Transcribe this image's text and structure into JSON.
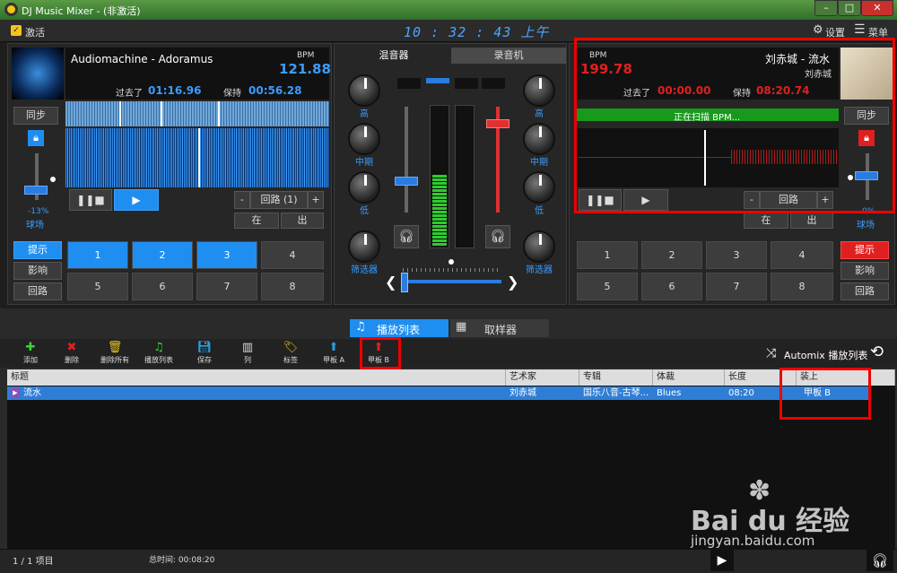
{
  "window": {
    "title": "DJ Music Mixer - (非激活)"
  },
  "menu": {
    "activate": "激活",
    "settings": "设置",
    "menu": "菜单"
  },
  "clock": "10 : 32 : 43 上午",
  "deckA": {
    "title": "Audiomachine - Adoramus",
    "bpm_label": "BPM",
    "bpm": "121.88",
    "elapsed_label": "过去了",
    "elapsed": "01:16.96",
    "remain_label": "保持",
    "remain": "00:56.28",
    "sync": "同步",
    "pitch": "-13%",
    "pitch_label": "球场",
    "loop": "回路 (1)",
    "loop_minus": "-",
    "loop_plus": "+",
    "in": "在",
    "out": "出",
    "cue": "提示",
    "effect": "影响",
    "loopbtn": "回路",
    "pads": [
      "1",
      "2",
      "3",
      "4",
      "5",
      "6",
      "7",
      "8"
    ],
    "pitch_level": 0.4
  },
  "mixer": {
    "tab_mixer": "混音器",
    "tab_recorder": "录音机",
    "knobs_left": [
      "高",
      "中期",
      "低"
    ],
    "knobs_right": [
      "高",
      "中期",
      "低"
    ],
    "filter": "筛选器",
    "crossfader": 0.05
  },
  "deckB": {
    "title": "刘赤城 - 流水",
    "artist": "刘赤城",
    "bpm_label": "BPM",
    "bpm": "199.78",
    "elapsed_label": "过去了",
    "elapsed": "00:00.00",
    "remain_label": "保持",
    "remain": "08:20.74",
    "scanning": "正在扫描 BPM...",
    "sync": "同步",
    "pitch": "0%",
    "pitch_label": "球场",
    "loop": "回路",
    "loop_minus": "-",
    "loop_plus": "+",
    "in": "在",
    "out": "出",
    "cue": "提示",
    "effect": "影响",
    "loopbtn": "回路",
    "pads": [
      "1",
      "2",
      "3",
      "4",
      "5",
      "6",
      "7",
      "8"
    ]
  },
  "tabs": {
    "playlist": "播放列表",
    "sampler": "取样器"
  },
  "toolbar": [
    {
      "icon": "plus-icon",
      "label": "添加",
      "color": "#3bd33b"
    },
    {
      "icon": "delete-icon",
      "label": "删除",
      "color": "#e02020"
    },
    {
      "icon": "trash-icon",
      "label": "删除所有",
      "color": "#e8c21b"
    },
    {
      "icon": "playlist-icon",
      "label": "播放列表",
      "color": "#3bd33b"
    },
    {
      "icon": "save-icon",
      "label": "保存",
      "color": "#2a9de0"
    },
    {
      "icon": "columns-icon",
      "label": "列",
      "color": "#dddddd"
    },
    {
      "icon": "tag-icon",
      "label": "标签",
      "color": "#e8c21b"
    },
    {
      "icon": "arrow-up-icon",
      "label": "甲板 A",
      "color": "#2a9de0"
    },
    {
      "icon": "arrow-up-icon",
      "label": "甲板 B",
      "color": "#e02020"
    }
  ],
  "automix": "Automix 播放列表",
  "table": {
    "headers": [
      "标题",
      "艺术家",
      "专辑",
      "体裁",
      "长度",
      "装上"
    ],
    "rows": [
      [
        "流水",
        "刘赤城",
        "国乐八音-古琴...",
        "Blues",
        "08:20",
        "甲板 B"
      ]
    ]
  },
  "status": {
    "count": "1 / 1  项目",
    "total": "总时间: 00:08:20"
  },
  "watermark": {
    "brand": "Bai du 经验",
    "url": "jingyan.baidu.com"
  }
}
